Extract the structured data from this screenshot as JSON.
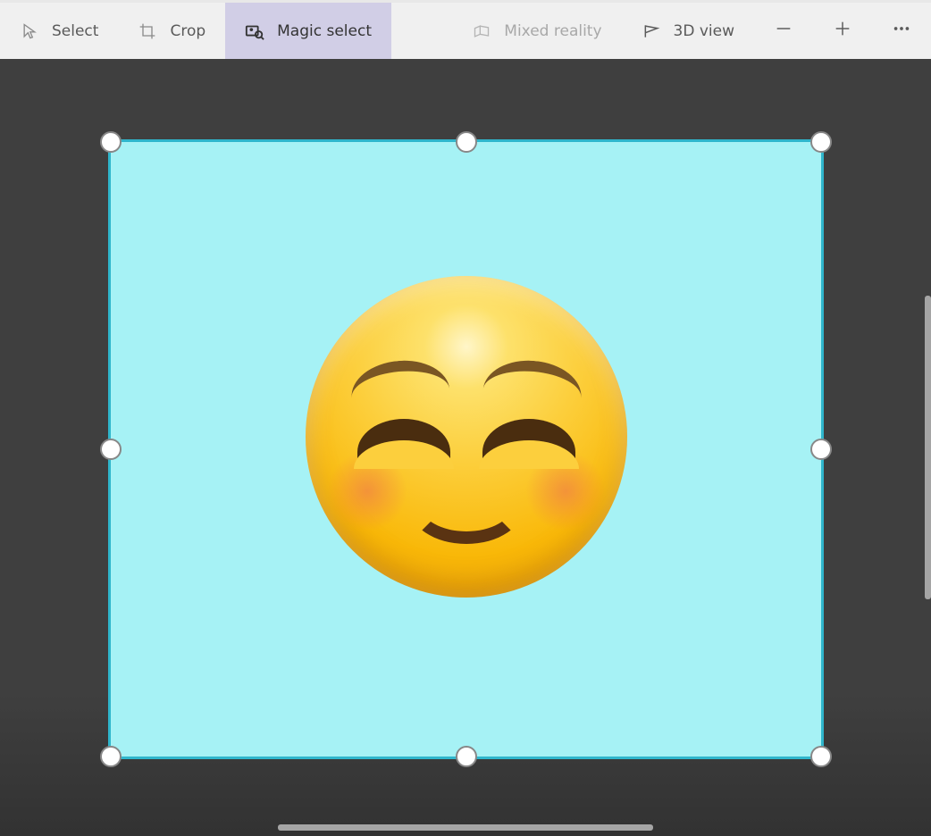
{
  "toolbar": {
    "tools": [
      {
        "id": "select",
        "label": "Select",
        "icon": "cursor",
        "state": "normal"
      },
      {
        "id": "crop",
        "label": "Crop",
        "icon": "crop",
        "state": "normal"
      },
      {
        "id": "magic-select",
        "label": "Magic select",
        "icon": "magic-select",
        "state": "active"
      },
      {
        "id": "mixed-reality",
        "label": "Mixed reality",
        "icon": "mixed-reality",
        "state": "disabled"
      },
      {
        "id": "3d-view",
        "label": "3D view",
        "icon": "3d-view",
        "state": "normal"
      }
    ],
    "zoom_out_label": "Zoom out",
    "zoom_in_label": "Zoom in",
    "more_label": "More options"
  },
  "canvas": {
    "background_color": "#a6f2f5",
    "selection_border_color": "#2fb6cc",
    "content": "smiling-face-with-blush-emoji",
    "handles": [
      "tl",
      "tm",
      "tr",
      "ml",
      "mr",
      "bl",
      "bm",
      "br"
    ]
  },
  "colors": {
    "toolbar_bg": "#f0f0f0",
    "toolbar_active_bg": "#d1cee6",
    "workspace_bg": "#3f3f3f"
  }
}
